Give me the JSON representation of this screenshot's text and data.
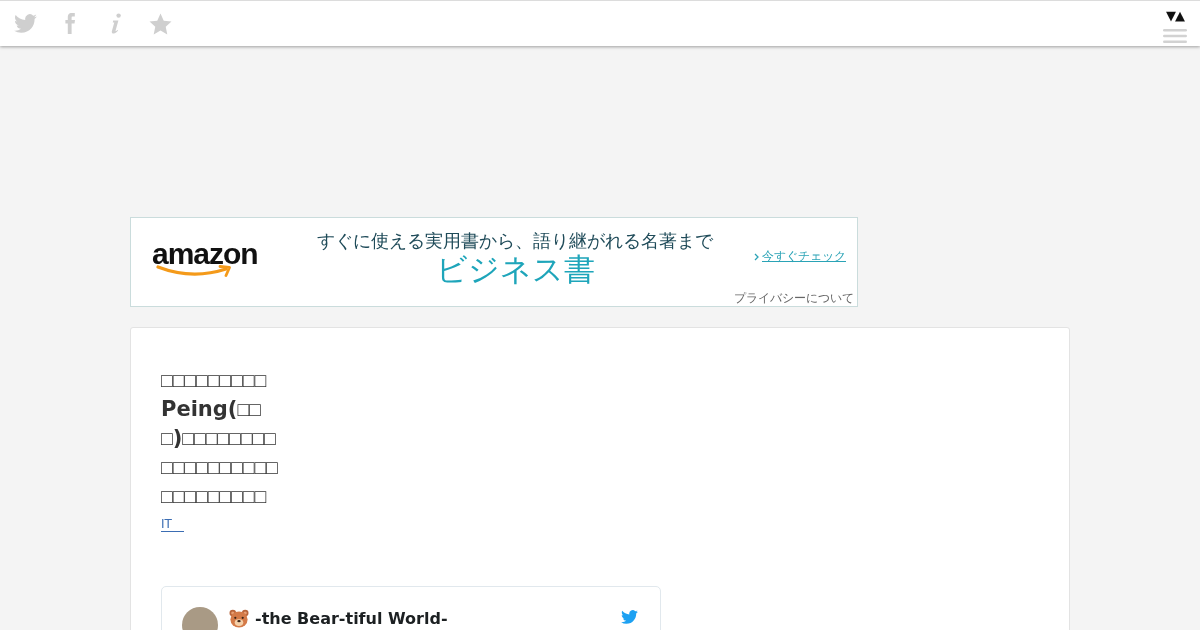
{
  "toolbar": {
    "toggle": "▼▲"
  },
  "ad": {
    "logo": "amazon",
    "tagline": "すぐに使える実用書から、語り継がれる名著まで",
    "headline": "ビジネス書",
    "cta": "今すぐチェック",
    "privacy": "プライバシーについて"
  },
  "article": {
    "title": "□□□□□□□□□Peing(□□□)□□□□□□□□□□□□□□□□□□□□□□□□□□□",
    "tag": "IT",
    "tweet": {
      "name": "-the Bear-tiful World-"
    }
  }
}
